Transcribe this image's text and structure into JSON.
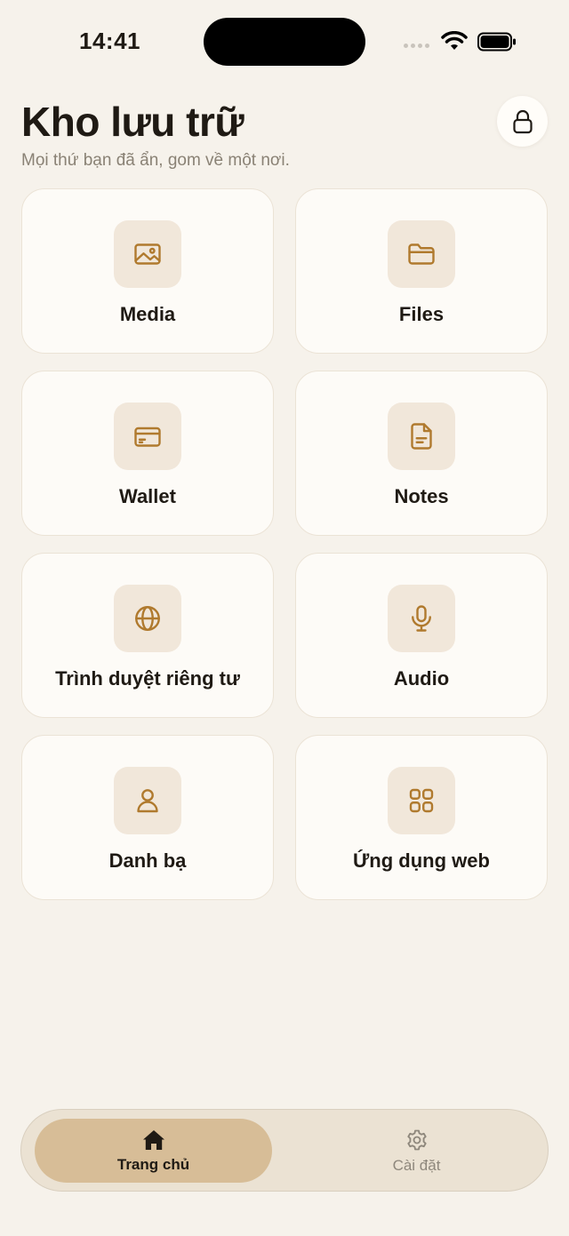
{
  "status_bar": {
    "time": "14:41"
  },
  "header": {
    "title": "Kho lưu trữ",
    "subtitle": "Mọi thứ bạn đã ẩn, gom về một nơi."
  },
  "cards": [
    {
      "label": "Media",
      "icon": "image-icon"
    },
    {
      "label": "Files",
      "icon": "folder-icon"
    },
    {
      "label": "Wallet",
      "icon": "credit-card-icon"
    },
    {
      "label": "Notes",
      "icon": "document-icon"
    },
    {
      "label": "Trình duyệt riêng tư",
      "icon": "globe-icon"
    },
    {
      "label": "Audio",
      "icon": "microphone-icon"
    },
    {
      "label": "Danh bạ",
      "icon": "person-icon"
    },
    {
      "label": "Ứng dụng web",
      "icon": "grid-icon"
    }
  ],
  "tab_bar": {
    "home_label": "Trang chủ",
    "settings_label": "Cài đặt",
    "active": "home"
  },
  "colors": {
    "background": "#f6f2eb",
    "accent": "#b07a2e",
    "active_tab": "#d7bd97"
  }
}
